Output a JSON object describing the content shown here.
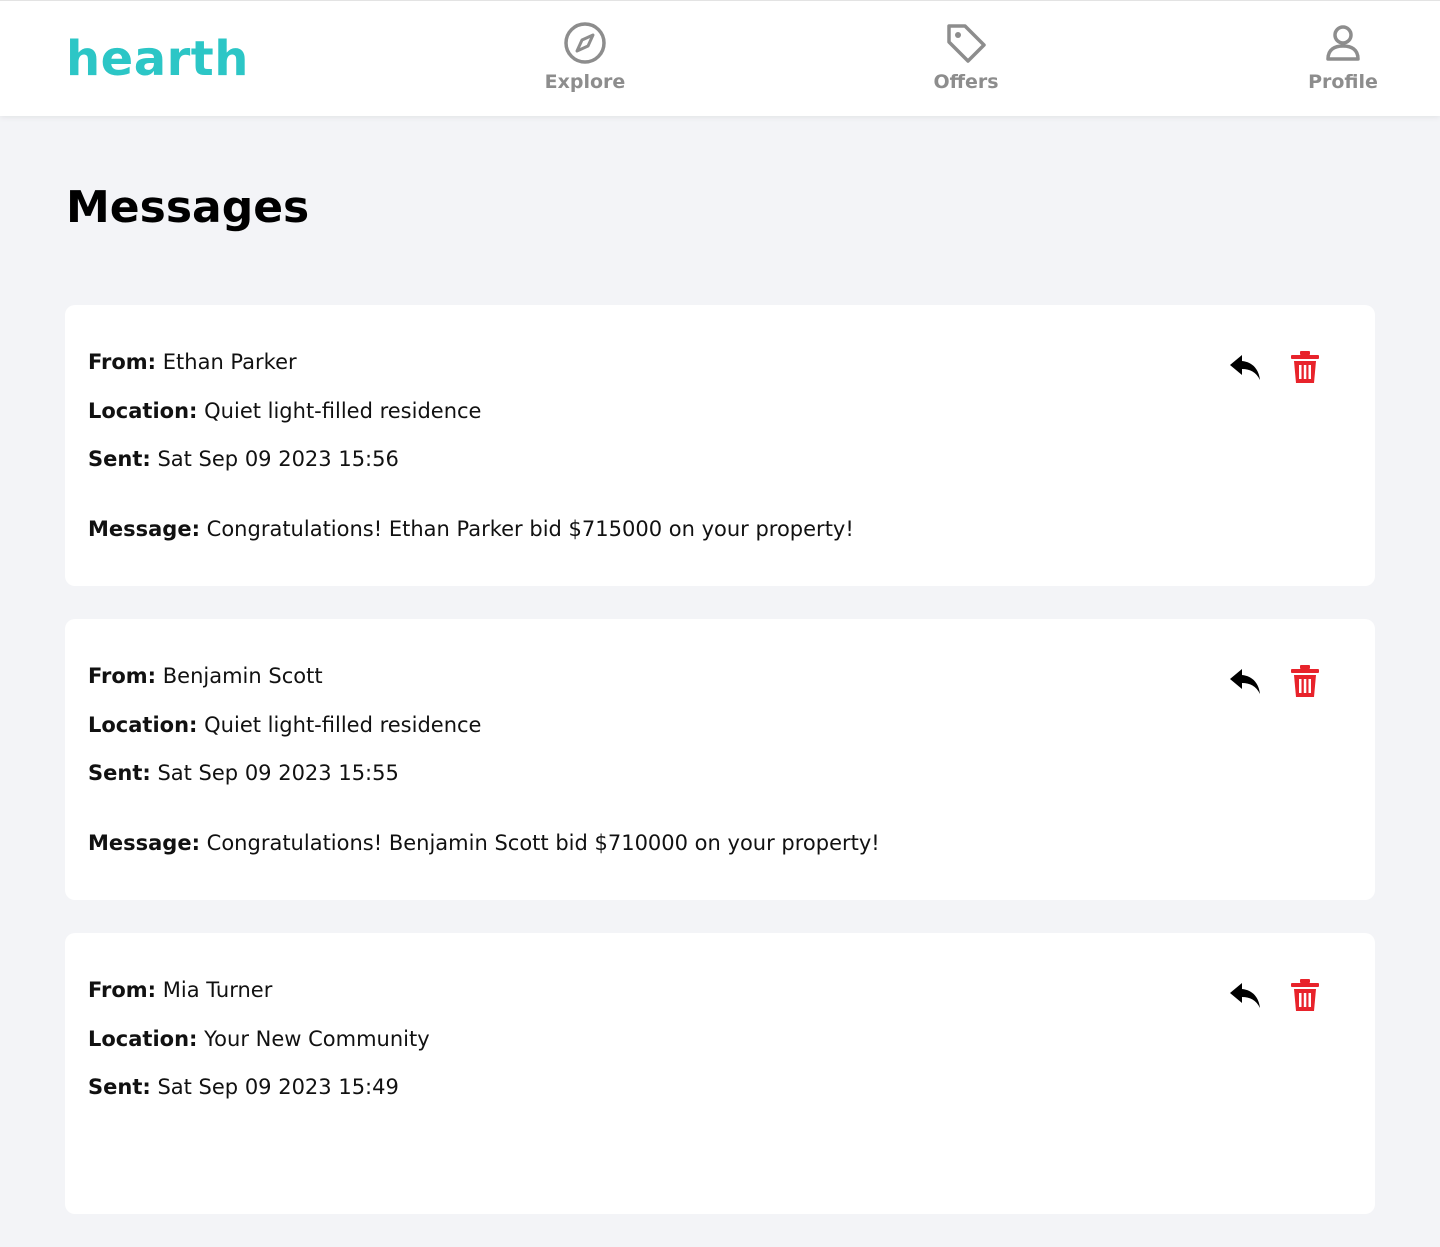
{
  "app": {
    "logo": "hearth"
  },
  "nav": [
    {
      "label": "Explore",
      "icon": "compass-icon"
    },
    {
      "label": "Offers",
      "icon": "tag-icon"
    },
    {
      "label": "Profile",
      "icon": "user-icon"
    }
  ],
  "page": {
    "title": "Messages"
  },
  "labels": {
    "from": "From:",
    "location": "Location:",
    "sent": "Sent:",
    "message": "Message:"
  },
  "messages": [
    {
      "from": "Ethan Parker",
      "location": "Quiet light-filled residence",
      "sent": "Sat Sep 09 2023 15:56",
      "message": "Congratulations! Ethan Parker bid $715000 on your property!"
    },
    {
      "from": "Benjamin Scott",
      "location": "Quiet light-filled residence",
      "sent": "Sat Sep 09 2023 15:55",
      "message": "Congratulations! Benjamin Scott bid $710000 on your property!"
    },
    {
      "from": "Mia Turner",
      "location": "Your New Community",
      "sent": "Sat Sep 09 2023 15:49",
      "message": ""
    }
  ],
  "colors": {
    "brand": "#2cc6c6",
    "delete": "#e8232b",
    "nav_gray": "#8d8d8d",
    "background": "#f3f4f7"
  }
}
